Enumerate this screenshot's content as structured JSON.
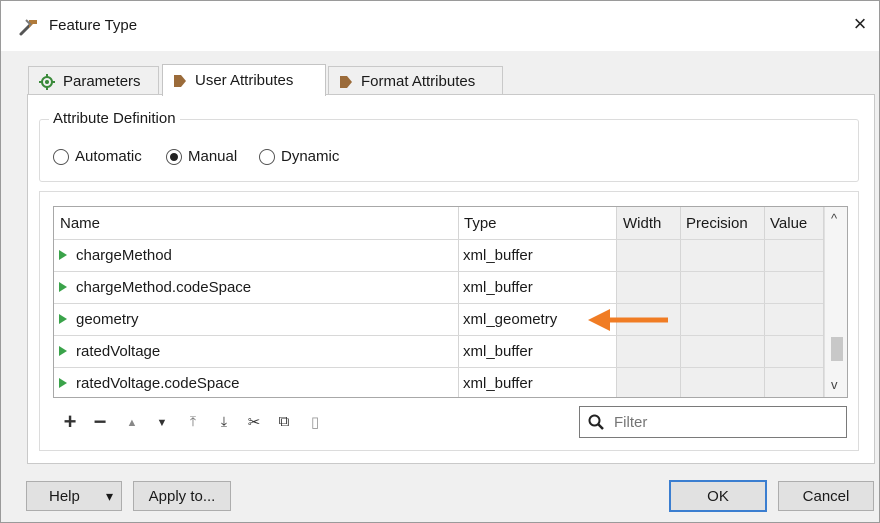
{
  "window": {
    "title": "Feature Type",
    "close_glyph": "×",
    "app_icon": "fme-wrench-icon"
  },
  "tabs": [
    {
      "label": "Parameters",
      "icon": "gear-icon",
      "active": false
    },
    {
      "label": "User Attributes",
      "icon": "attribute-arrow-icon",
      "active": true
    },
    {
      "label": "Format Attributes",
      "icon": "attribute-arrow-icon",
      "active": false
    }
  ],
  "attribute_definition": {
    "legend": "Attribute Definition",
    "options": [
      "Automatic",
      "Manual",
      "Dynamic"
    ],
    "selected": "Manual"
  },
  "table": {
    "columns": [
      "Name",
      "Type",
      "Width",
      "Precision",
      "Value"
    ],
    "rows": [
      {
        "name": "chargeMethod",
        "type": "xml_buffer"
      },
      {
        "name": "chargeMethod.codeSpace",
        "type": "xml_buffer"
      },
      {
        "name": "geometry",
        "type": "xml_geometry"
      },
      {
        "name": "ratedVoltage",
        "type": "xml_buffer"
      },
      {
        "name": "ratedVoltage.codeSpace",
        "type": "xml_buffer"
      }
    ],
    "scroll_up": "^",
    "scroll_down": "v"
  },
  "annotation": {
    "arrow_color": "#f07c24",
    "points_to_row": "geometry"
  },
  "toolbar": {
    "add": "+",
    "remove": "−",
    "move_up": "▲",
    "move_down": "▼",
    "move_top": "⤒",
    "move_bottom": "⤓",
    "cut": "✂",
    "copy": "⧉",
    "paste": "▯"
  },
  "filter": {
    "placeholder": "Filter",
    "value": ""
  },
  "buttons": {
    "help": "Help",
    "help_dropdown": "▾",
    "apply_to": "Apply to...",
    "ok": "OK",
    "cancel": "Cancel"
  },
  "colors": {
    "accent": "#3b7ed0",
    "tree_arrow": "#3aa34a",
    "tab_icon": "#9b6b3a"
  }
}
